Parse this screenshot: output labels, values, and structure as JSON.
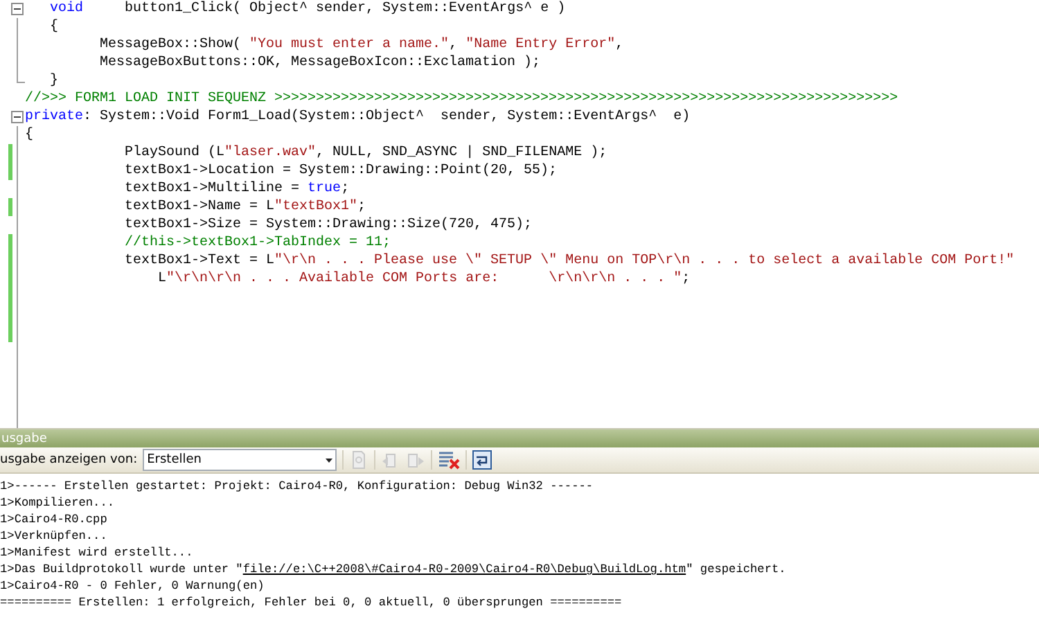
{
  "editor": {
    "lines": [
      {
        "kind": "foldstart",
        "changed": false,
        "segments": [
          {
            "kind": "keyword",
            "text": "   void"
          },
          {
            "kind": "plain",
            "text": "     button1_Click( Object^ sender, System::EventArgs^ e )"
          }
        ]
      },
      {
        "kind": "foldbody",
        "changed": false,
        "segments": [
          {
            "kind": "plain",
            "text": "   {"
          }
        ]
      },
      {
        "kind": "foldbody",
        "changed": false,
        "segments": [
          {
            "kind": "plain",
            "text": "         MessageBox::Show( "
          },
          {
            "kind": "string",
            "text": "\"You must enter a name.\""
          },
          {
            "kind": "plain",
            "text": ", "
          },
          {
            "kind": "string",
            "text": "\"Name Entry Error\""
          },
          {
            "kind": "plain",
            "text": ","
          }
        ]
      },
      {
        "kind": "foldbody",
        "changed": false,
        "segments": [
          {
            "kind": "plain",
            "text": "         MessageBoxButtons::OK, MessageBoxIcon::Exclamation );"
          }
        ]
      },
      {
        "kind": "foldend",
        "changed": false,
        "segments": [
          {
            "kind": "plain",
            "text": "   }"
          }
        ]
      },
      {
        "kind": "plain",
        "changed": false,
        "segments": [
          {
            "kind": "comment",
            "text": "//>>> FORM1 LOAD INIT SEQUENZ >>>>>>>>>>>>>>>>>>>>>>>>>>>>>>>>>>>>>>>>>>>>>>>>>>>>>>>>>>>>>>>>>>>>>>>>>>>"
          }
        ]
      },
      {
        "kind": "foldstart",
        "changed": false,
        "segments": [
          {
            "kind": "keyword",
            "text": "private"
          },
          {
            "kind": "plain",
            "text": ": System::Void Form1_Load(System::Object^  sender, System::EventArgs^  e)"
          }
        ]
      },
      {
        "kind": "foldbody",
        "changed": false,
        "segments": [
          {
            "kind": "plain",
            "text": "{"
          }
        ]
      },
      {
        "kind": "foldbody",
        "changed": true,
        "segments": [
          {
            "kind": "plain",
            "text": "            PlaySound (L"
          },
          {
            "kind": "string",
            "text": "\"laser.wav\""
          },
          {
            "kind": "plain",
            "text": ", NULL, SND_ASYNC | SND_FILENAME );"
          }
        ]
      },
      {
        "kind": "foldbody",
        "changed": true,
        "segments": [
          {
            "kind": "plain",
            "text": "            textBox1->Location = System::Drawing::Point(20, 55);"
          }
        ]
      },
      {
        "kind": "foldbody",
        "changed": false,
        "segments": [
          {
            "kind": "plain",
            "text": "            textBox1->Multiline = "
          },
          {
            "kind": "keyword",
            "text": "true"
          },
          {
            "kind": "plain",
            "text": ";"
          }
        ]
      },
      {
        "kind": "foldbody",
        "changed": true,
        "segments": [
          {
            "kind": "plain",
            "text": "            textBox1->Name = L"
          },
          {
            "kind": "string",
            "text": "\"textBox1\""
          },
          {
            "kind": "plain",
            "text": ";"
          }
        ]
      },
      {
        "kind": "foldbody",
        "changed": false,
        "segments": [
          {
            "kind": "plain",
            "text": "            textBox1->Size = System::Drawing::Size(720, 475);"
          }
        ]
      },
      {
        "kind": "foldbody",
        "changed": true,
        "segments": [
          {
            "kind": "comment",
            "text": "            //this->textBox1->TabIndex = 11;"
          }
        ]
      },
      {
        "kind": "foldbody",
        "changed": true,
        "segments": [
          {
            "kind": "plain",
            "text": "            textBox1->Text = L"
          },
          {
            "kind": "string",
            "text": "\"\\r\\n . . . Please use \\\" SETUP \\\" Menu on TOP\\r\\n . . . to select a available COM Port!\""
          }
        ]
      },
      {
        "kind": "foldbody",
        "changed": true,
        "segments": [
          {
            "kind": "plain",
            "text": "                L"
          },
          {
            "kind": "string",
            "text": "\"\\r\\n\\r\\n . . . Available COM Ports are:      \\r\\n\\r\\n . . . \""
          },
          {
            "kind": "plain",
            "text": ";"
          }
        ]
      },
      {
        "kind": "foldbody",
        "changed": true
      },
      {
        "kind": "foldbody",
        "changed": true
      },
      {
        "kind": "foldbody",
        "changed": true
      }
    ]
  },
  "output": {
    "title": "usgabe",
    "show_from_label": "usgabe anzeigen von:",
    "source": "Erstellen",
    "lines": [
      [
        {
          "kind": "plain",
          "text": "1>------ Erstellen gestartet: Projekt: Cairo4-R0, Konfiguration: Debug Win32 ------"
        }
      ],
      [
        {
          "kind": "plain",
          "text": "1>Kompilieren..."
        }
      ],
      [
        {
          "kind": "plain",
          "text": "1>Cairo4-R0.cpp"
        }
      ],
      [
        {
          "kind": "plain",
          "text": "1>Verknüpfen..."
        }
      ],
      [
        {
          "kind": "plain",
          "text": "1>Manifest wird erstellt..."
        }
      ],
      [
        {
          "kind": "plain",
          "text": "1>Das Buildprotokoll wurde unter \""
        },
        {
          "kind": "link",
          "text": "file://e:\\C++2008\\#Cairo4-R0-2009\\Cairo4-R0\\Debug\\BuildLog.htm"
        },
        {
          "kind": "plain",
          "text": "\" gespeichert."
        }
      ],
      [
        {
          "kind": "plain",
          "text": "1>Cairo4-R0 - 0 Fehler, 0 Warnung(en)"
        }
      ],
      [
        {
          "kind": "plain",
          "text": "========== Erstellen: 1 erfolgreich, Fehler bei 0, 0 aktuell, 0 übersprungen =========="
        }
      ]
    ]
  }
}
